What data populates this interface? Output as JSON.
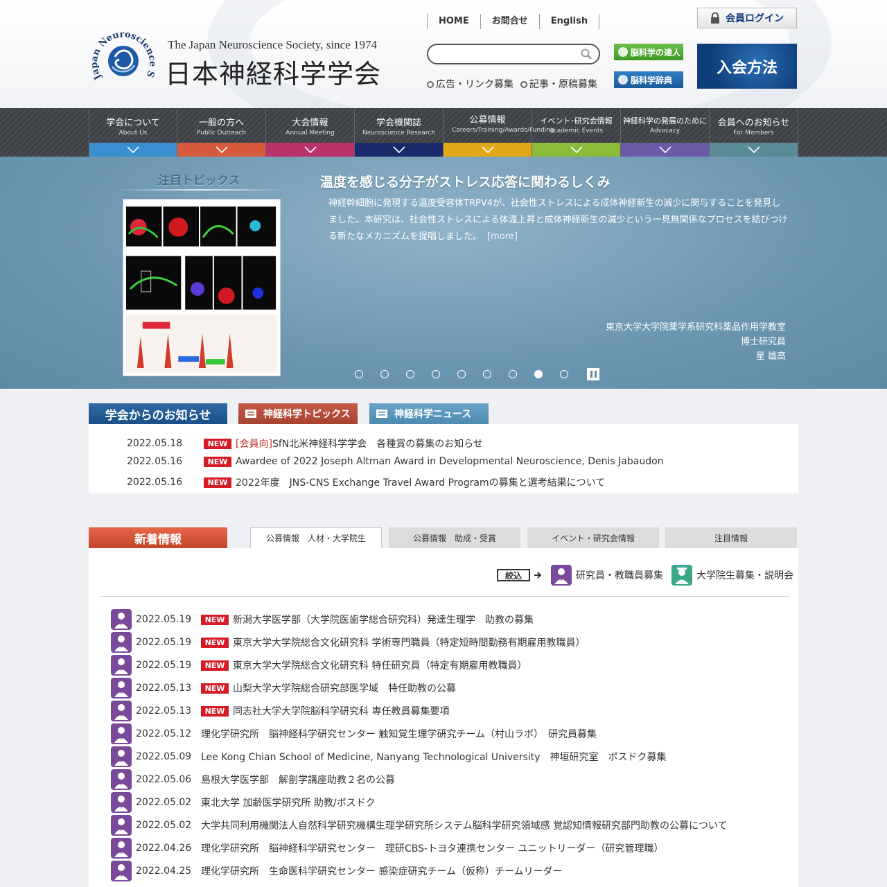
{
  "header": {
    "tagline": "The Japan Neuroscience Society, since 1974",
    "site_name": "日本神経科学学会",
    "logo_ring": "Japan Neuroscience Society",
    "topnav": [
      "HOME",
      "お問合せ",
      "English"
    ],
    "search_placeholder": "",
    "sublinks": [
      "広告・リンク募集",
      "記事・原稿募集"
    ],
    "banner_tatsujin": "脳科学の達人",
    "banner_jiten": "脳科学辞典",
    "login_label": "会員ログイン",
    "join_label": "入会方法"
  },
  "mainnav": [
    {
      "jp": "学会について",
      "en": "About Us",
      "color": "#3a8fd0"
    },
    {
      "jp": "一般の方へ",
      "en": "Public Outreach",
      "color": "#d85a3c"
    },
    {
      "jp": "大会情報",
      "en": "Annual Meeting",
      "color": "#b8336a"
    },
    {
      "jp": "学会機関誌",
      "en": "Neuroscience Research",
      "color": "#1a2a6a"
    },
    {
      "jp": "公募情報",
      "en": "Careers/Training/Awards/Funding",
      "color": "#e2a81a"
    },
    {
      "jp": "イベント･研究会情報",
      "en": "Academic Events",
      "color": "#8cbb3a"
    },
    {
      "jp": "神経科学の発展のために",
      "en": "Advocacy",
      "color": "#6a5aa8"
    },
    {
      "jp": "会員へのお知らせ",
      "en": "For Members",
      "color": "#5a8a96"
    }
  ],
  "hero": {
    "label": "注目トピックス",
    "title": "温度を感じる分子がストレス応答に関わるしくみ",
    "body": "神経幹細胞に発現する温度受容体TRPV4が、社会性ストレスによる成体神経新生の減少に関与することを発見しました。本研究は、社会性ストレスによる体温上昇と成体神経新生の減少という一見無関係なプロセスを結びつける新たなメカニズムを提唱しました。",
    "more": "[more]",
    "credit": [
      "東京大学大学院薬学系研究科薬品作用学教室",
      "博士研究員",
      "星 雄高"
    ],
    "dot_count": 9,
    "active_dot": 8
  },
  "notice": {
    "tabs": [
      "学会からのお知らせ",
      "神経科学トピックス",
      "神経科学ニュース"
    ],
    "new_label": "NEW",
    "items": [
      {
        "date": "2022.05.18",
        "tag": "[会員向]",
        "title": "SfN北米神経科学学会　各種賞の募集のお知らせ"
      },
      {
        "date": "2022.05.16",
        "tag": "",
        "title": "Awardee of 2022 Joseph Altman Award in Developmental Neuroscience, Denis Jabaudon"
      },
      {
        "date": "2022.05.16",
        "tag": "",
        "title": "2022年度　JNS-CNS Exchange Travel Award Programの募集と選考結果について"
      }
    ]
  },
  "newinfo": {
    "tab": "新着情報",
    "subtabs": [
      "公募情報　人材・大学院生",
      "公募情報　助成・受賞",
      "イベント・研究会情報",
      "注目情報"
    ],
    "filter_label": "絞込",
    "filters": [
      "研究員・教職員募集",
      "大学院生募集・説明会"
    ],
    "new_label": "NEW",
    "items": [
      {
        "date": "2022.05.19",
        "new": true,
        "title": "新潟大学医学部（大学院医歯学総合研究科）発達生理学　助教の募集"
      },
      {
        "date": "2022.05.19",
        "new": true,
        "title": "東京大学大学院総合文化研究科 学術専門職員（特定短時間勤務有期雇用教職員）"
      },
      {
        "date": "2022.05.19",
        "new": true,
        "title": "東京大学大学院総合文化研究科 特任研究員（特定有期雇用教職員）"
      },
      {
        "date": "2022.05.13",
        "new": true,
        "title": "山梨大学大学院総合研究部医学域　特任助教の公募"
      },
      {
        "date": "2022.05.13",
        "new": true,
        "title": "同志社大学大学院脳科学研究科 専任教員募集要項"
      },
      {
        "date": "2022.05.12",
        "new": false,
        "title": "理化学研究所　脳神経科学研究センター 触知覚生理学研究チーム（村山ラボ）　研究員募集"
      },
      {
        "date": "2022.05.09",
        "new": false,
        "title": "Lee Kong Chian School of Medicine, Nanyang Technological University　神垣研究室　ポスドク募集"
      },
      {
        "date": "2022.05.06",
        "new": false,
        "title": "島根大学医学部　解剖学講座助教２名の公募"
      },
      {
        "date": "2022.05.02",
        "new": false,
        "title": "東北大学 加齢医学研究所 助教/ポスドク"
      },
      {
        "date": "2022.05.02",
        "new": false,
        "title": "大学共同利用機関法人自然科学研究機構生理学研究所システム脳科学研究領域感 覚認知情報研究部門助教の公募について"
      },
      {
        "date": "2022.04.26",
        "new": false,
        "title": "理化学研究所　脳神経科学研究センター　理研CBS-トヨタ連携センター ユニットリーダー（研究管理職）"
      },
      {
        "date": "2022.04.25",
        "new": false,
        "title": "理化学研究所　生命医科学研究センター 感染症研究チーム（仮称）チームリーダー"
      }
    ]
  }
}
